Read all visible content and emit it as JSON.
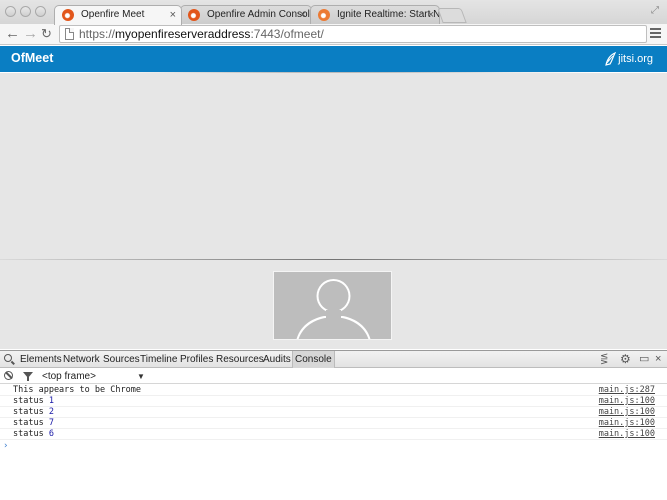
{
  "browser": {
    "tabs": [
      {
        "label": "Openfire Meet",
        "active": true
      },
      {
        "label": "Openfire Admin Console: S",
        "active": false
      },
      {
        "label": "Ignite Realtime: Start New",
        "active": false
      }
    ],
    "tab_close_glyph": "×",
    "url_scheme": "https://",
    "url_host": "myopenfireserveraddress",
    "url_rest": ":7443/ofmeet/",
    "icons": [
      "back-icon",
      "forward-icon",
      "reload-icon",
      "page-icon",
      "menu-icon"
    ]
  },
  "app": {
    "title": "OfMeet",
    "brand": "jitsi.org",
    "header_color": "#0a7ec3"
  },
  "devtools": {
    "tabs": [
      "Elements",
      "Network",
      "Sources",
      "Timeline",
      "Profiles",
      "Resources",
      "Audits",
      "Console"
    ],
    "selected_tab": "Console",
    "frame": "<top frame>",
    "console": [
      {
        "text": "This appears to be Chrome",
        "value": "",
        "source": "main.js:287"
      },
      {
        "text": "status ",
        "value": "1",
        "source": "main.js:100"
      },
      {
        "text": "status ",
        "value": "2",
        "source": "main.js:100"
      },
      {
        "text": "status ",
        "value": "7",
        "source": "main.js:100"
      },
      {
        "text": "status ",
        "value": "6",
        "source": "main.js:100"
      }
    ],
    "prompt": "›"
  }
}
